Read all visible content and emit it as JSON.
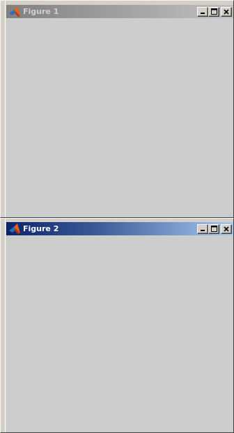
{
  "windows": [
    {
      "title": "Figure 1",
      "active": false,
      "icon": "matlab-icon",
      "buttons": [
        "minimize-icon",
        "maximize-icon",
        "close-icon"
      ]
    },
    {
      "title": "Figure 2",
      "active": true,
      "icon": "matlab-icon",
      "buttons": [
        "minimize-icon",
        "maximize-icon",
        "close-icon"
      ]
    }
  ],
  "colors": {
    "inactive_title_start": "#808080",
    "inactive_title_end": "#c0c0c0",
    "active_title_start": "#0a246a",
    "active_title_end": "#a6caf0",
    "client_background": "#cdcdcd",
    "window_face": "#d4d0c8"
  }
}
